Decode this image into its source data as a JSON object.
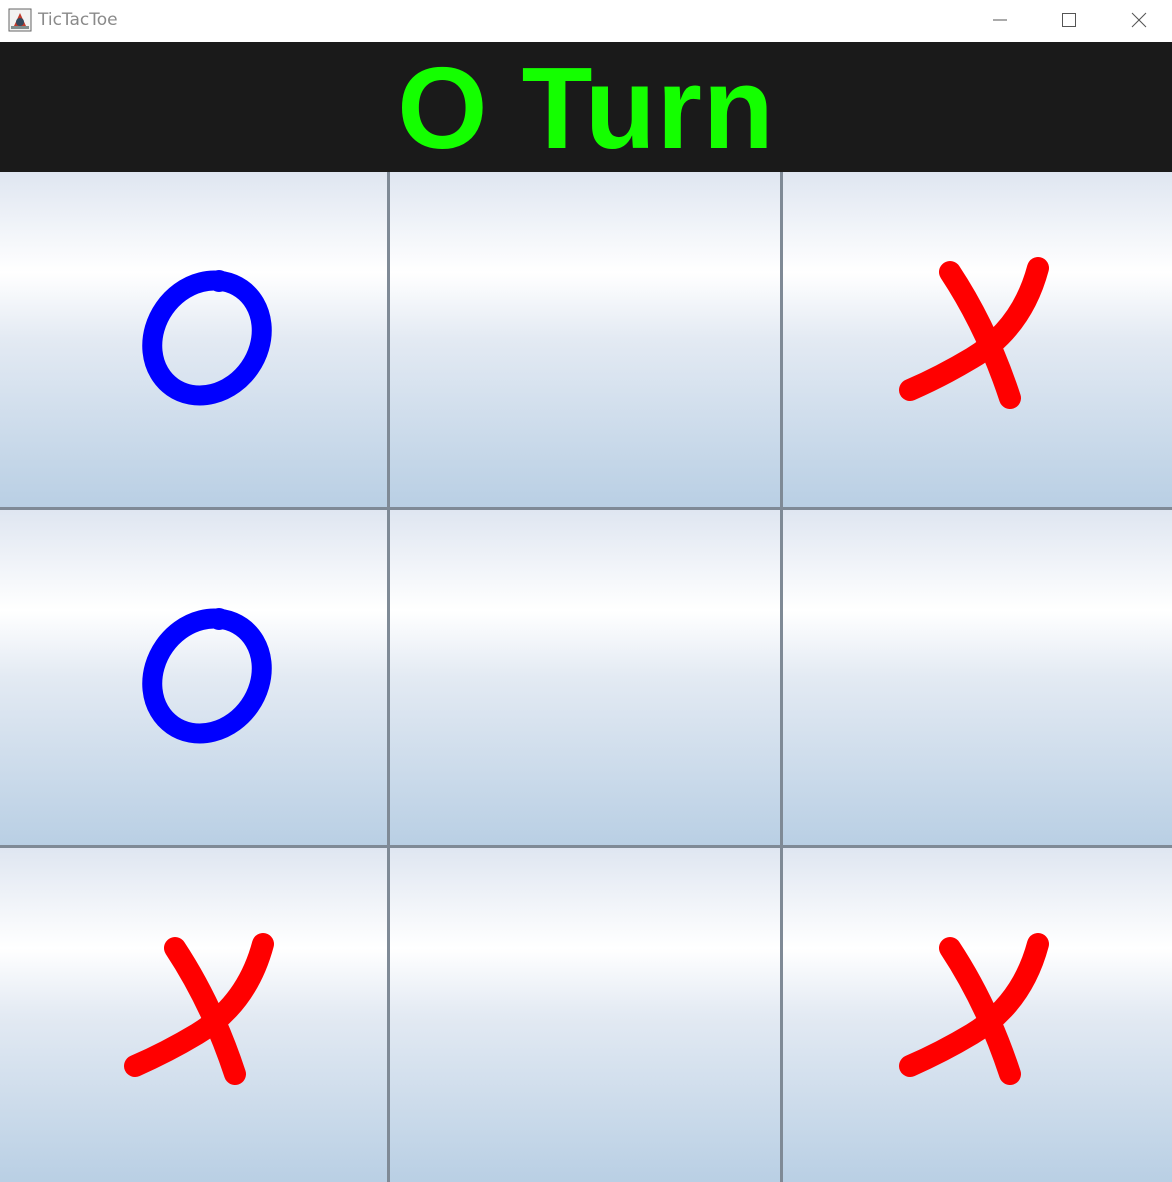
{
  "window": {
    "title": "TicTacToe",
    "controls": [
      "minimize",
      "maximize",
      "close"
    ]
  },
  "header": {
    "turn_text": "O Turn",
    "color": "#14ff00",
    "background": "#1a1a1a"
  },
  "board": {
    "cells": [
      [
        "O",
        "",
        "X"
      ],
      [
        "O",
        "",
        ""
      ],
      [
        "X",
        "",
        "X"
      ]
    ],
    "x_color": "#ff0000",
    "o_color": "#0000ff"
  }
}
